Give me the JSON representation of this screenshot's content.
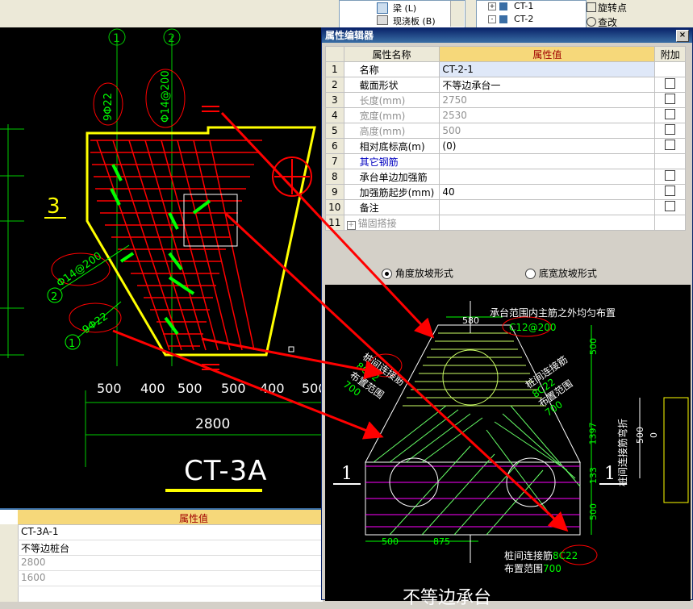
{
  "top": {
    "tree_left": [
      {
        "label": "梁 (L)"
      },
      {
        "label": "现浇板 (B)"
      }
    ],
    "tree_right": [
      {
        "label": "CT-1"
      },
      {
        "label": "CT-2"
      }
    ],
    "rotate_btn": "旋转点",
    "find_btn": "查改"
  },
  "cad": {
    "axis1": "1",
    "axis2": "2",
    "rebar_9b22_top": "9Φ22",
    "rebar_14at200_top": "Φ14@200",
    "rebar_14at200_side": "Φ14@200",
    "rebar_9b22_bottom": "9Φ22",
    "marker2": "2",
    "marker1": "1",
    "section3": "3",
    "dims": [
      "500",
      "400",
      "500",
      "500",
      "400",
      "500"
    ],
    "total_dim": "2800",
    "title": "CT-3A"
  },
  "bottom_table": {
    "header": "属性值",
    "rows": [
      "CT-3A-1",
      "不等边桩台",
      "2800",
      "1600"
    ]
  },
  "editor": {
    "title": "属性编辑器",
    "close": "×",
    "col_name": "属性名称",
    "col_value": "属性值",
    "col_extra": "附加",
    "rows": [
      {
        "num": "1",
        "name": "名称",
        "value": "CT-2-1",
        "style": "normal",
        "check": false
      },
      {
        "num": "2",
        "name": "截面形状",
        "value": "不等边承台一",
        "style": "normal",
        "check": true
      },
      {
        "num": "3",
        "name": "长度(mm)",
        "value": "2750",
        "style": "gray",
        "check": true
      },
      {
        "num": "4",
        "name": "宽度(mm)",
        "value": "2530",
        "style": "gray",
        "check": true
      },
      {
        "num": "5",
        "name": "高度(mm)",
        "value": "500",
        "style": "gray",
        "check": true
      },
      {
        "num": "6",
        "name": "相对底标高(m)",
        "value": "(0)",
        "style": "normal",
        "check": true
      },
      {
        "num": "7",
        "name": "其它钢筋",
        "value": "",
        "style": "blue",
        "check": false
      },
      {
        "num": "8",
        "name": "承台单边加强筋",
        "value": "",
        "style": "normal",
        "check": true
      },
      {
        "num": "9",
        "name": "加强筋起步(mm)",
        "value": "40",
        "style": "normal",
        "check": true
      },
      {
        "num": "10",
        "name": "备注",
        "value": "",
        "style": "normal",
        "check": true
      },
      {
        "num": "11",
        "name": "锚固搭接",
        "value": "",
        "style": "gray",
        "check": false
      }
    ],
    "expand": "+",
    "radio1": "角度放坡形式",
    "radio2": "底宽放坡形式"
  },
  "diagram": {
    "top_note": "承台范围内主筋之外均匀布置",
    "c12": "C12@200",
    "d580": "580",
    "d500a": "500",
    "left_note1": "桩间连接筋",
    "left_note2": "8C22",
    "left_note3": "布置范围",
    "left_note4": "700",
    "right_note1": "桩间连接筋",
    "right_note2": "8C22",
    "right_note3": "布置范围",
    "right_note4": "700",
    "d1397": "1397",
    "d133": "133",
    "d500b": "500",
    "bottom_d500": "500",
    "bottom_d875": "875",
    "bottom_note1": "桩间连接筋",
    "bottom_note2": "8C22",
    "bottom_note3": "布置范围",
    "bottom_note4": "700",
    "sec_left": "1",
    "sec_right": "1",
    "footer": "不等边承台",
    "side_d500": "500",
    "side_d0": "0",
    "side_text": "桩间连接筋弯折"
  }
}
